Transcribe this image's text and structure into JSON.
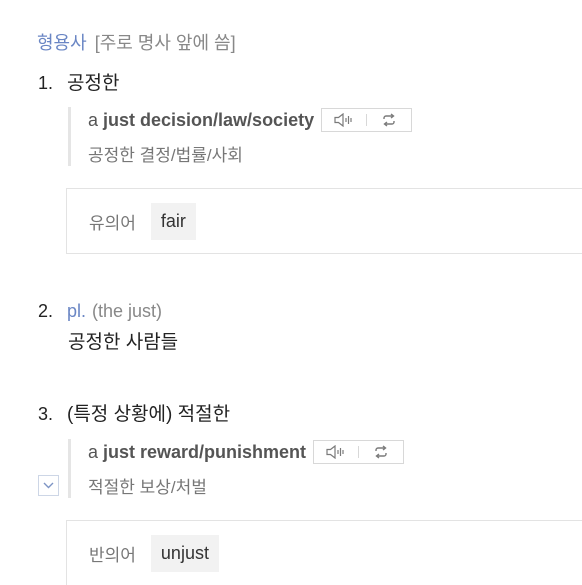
{
  "pos": {
    "word": "형용사",
    "note": "[주로 명사 앞에 씀]"
  },
  "senses": [
    {
      "number": "1.",
      "definition": "공정한",
      "example": {
        "prefix": "a ",
        "keyword": "just decision/law/society",
        "translation": "공정한 결정/법률/사회"
      },
      "synonym": {
        "label": "유의어",
        "word": "fair"
      }
    },
    {
      "number": "2.",
      "plural_label": "pl.",
      "note": "(the just)",
      "definition": "공정한 사람들"
    },
    {
      "number": "3.",
      "definition": "(특정 상황에) 적절한",
      "example": {
        "prefix": "a ",
        "keyword": "just reward/punishment",
        "translation": "적절한 보상/처벌"
      },
      "antonym": {
        "label": "반의어",
        "word": "unjust"
      }
    }
  ],
  "icons": {
    "audio": "speaker-icon",
    "repeat": "repeat-icon",
    "expand": "chevron-down-icon"
  },
  "colors": {
    "accent": "#6a86c4",
    "text": "#222222",
    "muted": "#888888",
    "chip_bg": "#f2f2f2"
  }
}
